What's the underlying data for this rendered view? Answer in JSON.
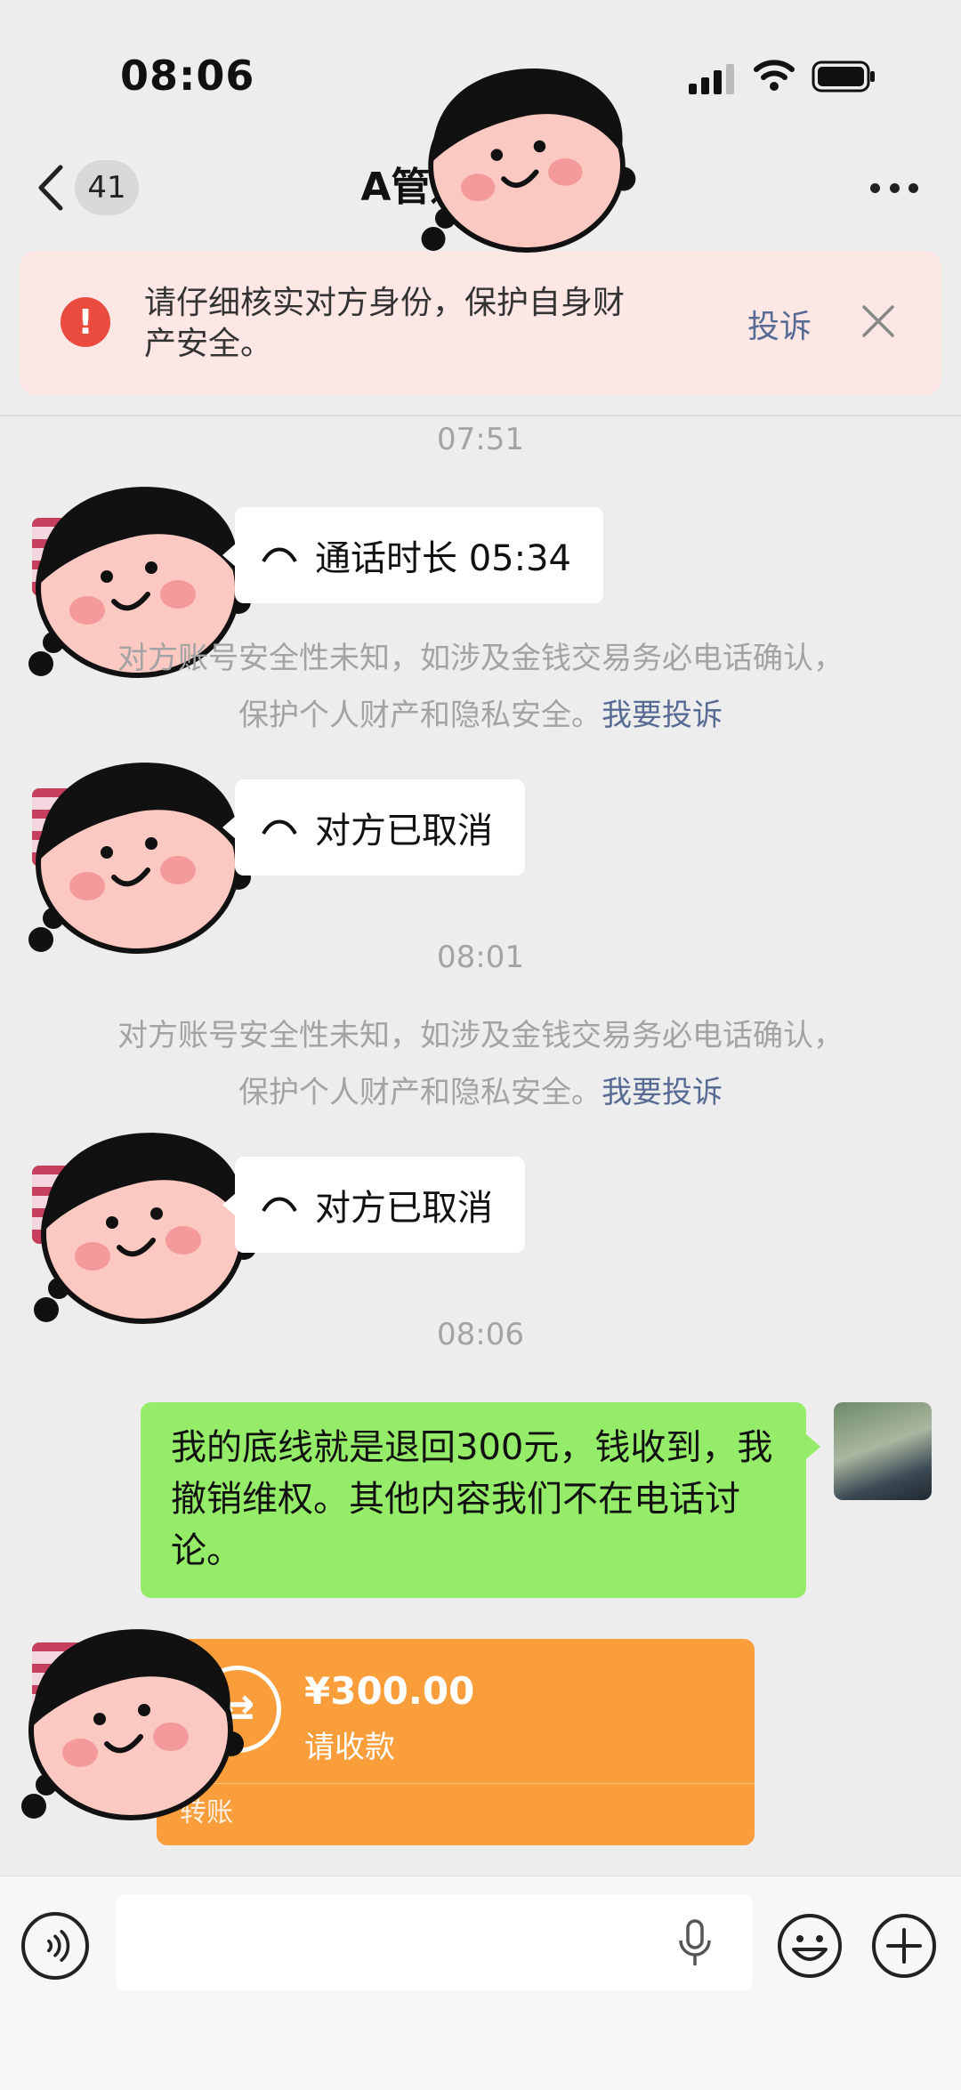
{
  "status_bar": {
    "time": "08:06"
  },
  "nav": {
    "unread_count": "41",
    "title": "A管道疏 清理"
  },
  "safety_banner": {
    "text": "请仔细核实对方身份，保护自身财产安全。",
    "report": "投诉"
  },
  "messages": {
    "ts1": "07:51",
    "call_duration": "通话时长 05:34",
    "notice1_line1": "对方账号安全性未知，如涉及金钱交易务必电话确认，",
    "notice1_line2": "保护个人财产和隐私安全。",
    "notice1_link": "我要投诉",
    "cancelled1": "对方已取消",
    "ts2": "08:01",
    "notice2_line1": "对方账号安全性未知，如涉及金钱交易务必电话确认，",
    "notice2_line2": "保护个人财产和隐私安全。",
    "notice2_link": "我要投诉",
    "cancelled2": "对方已取消",
    "ts3": "08:06",
    "my_message": "我的底线就是退回300元，钱收到，我撤销维权。其他内容我们不在电话讨论。"
  },
  "transfer": {
    "amount": "¥300.00",
    "status": "请收款",
    "label": "转账",
    "icon_symbol": "⇄"
  },
  "colors": {
    "bubble_mine": "#95ec69",
    "transfer": "#fa9d3b",
    "link": "#576b95",
    "warning": "#eb4b3f"
  }
}
